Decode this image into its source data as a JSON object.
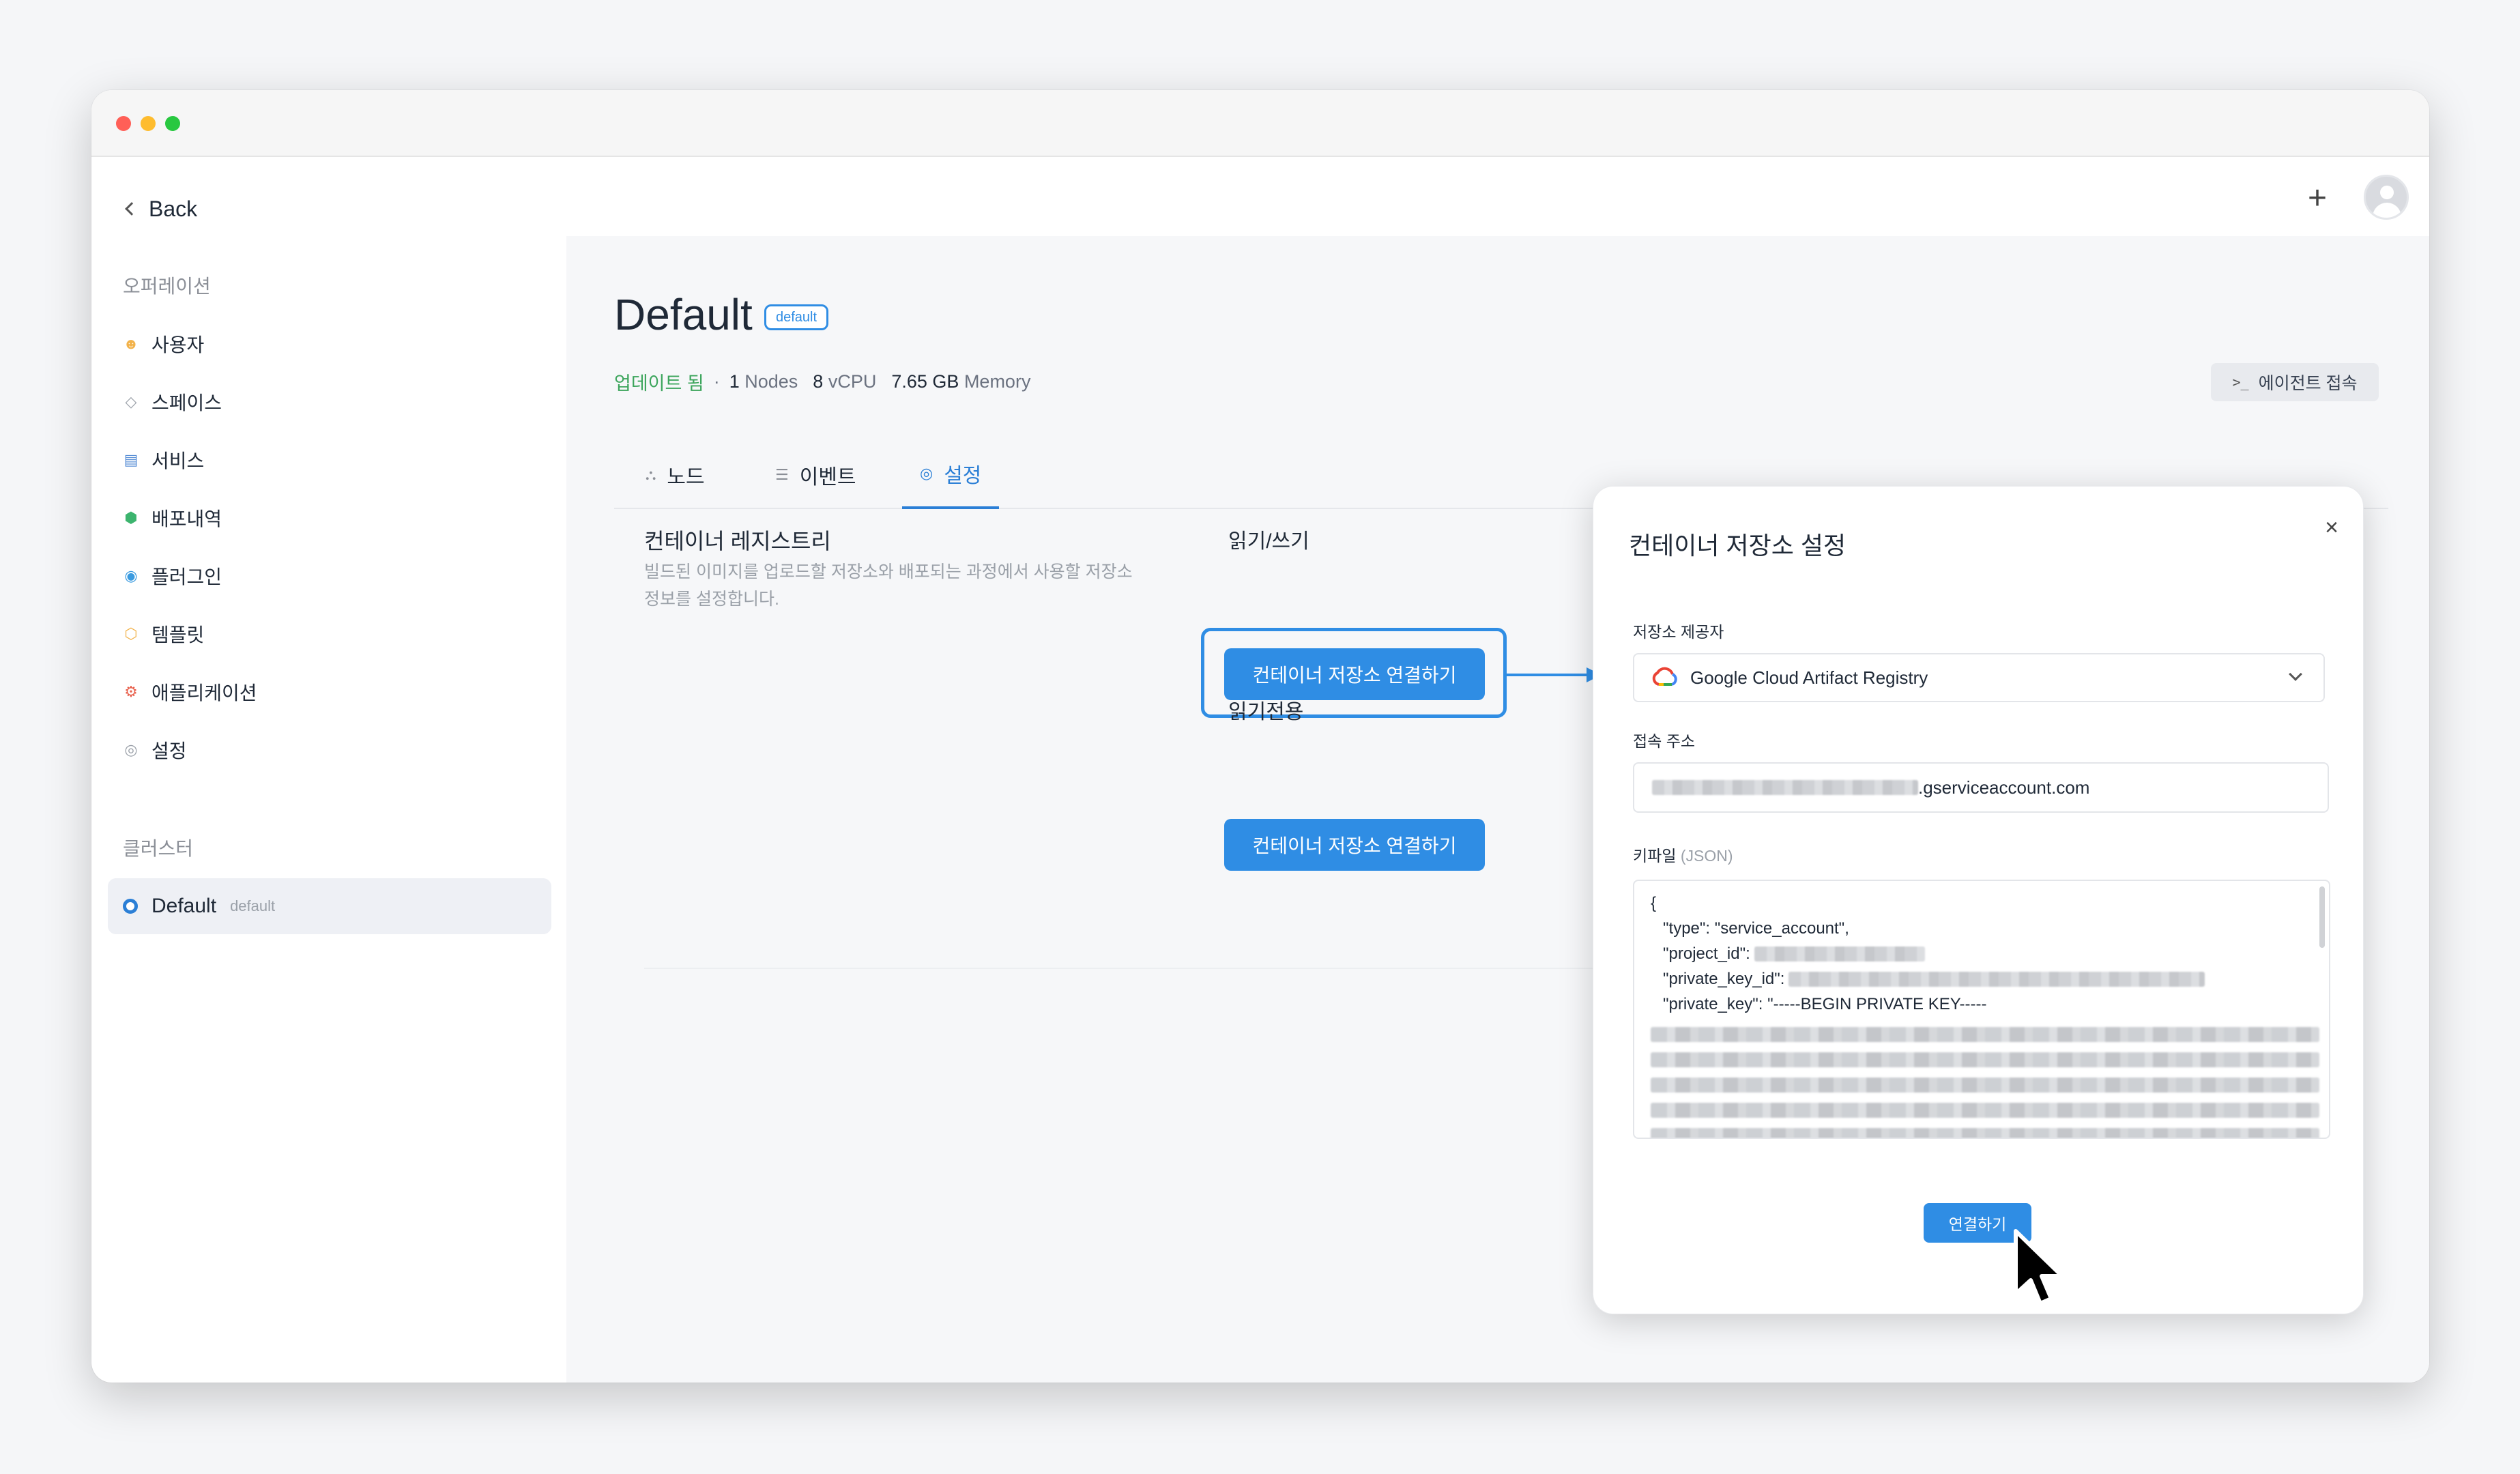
{
  "window": {
    "controls": [
      "close",
      "minimize",
      "maximize"
    ]
  },
  "header": {
    "back_label": "Back",
    "plus_label": "+"
  },
  "sidebar": {
    "section_ops": "오퍼레이션",
    "items": [
      {
        "label": "사용자",
        "icon": "users-icon",
        "color": "#f2b24a"
      },
      {
        "label": "스페이스",
        "icon": "layers-icon",
        "color": "#9aa0a8"
      },
      {
        "label": "서비스",
        "icon": "window-icon",
        "color": "#5a8fd6"
      },
      {
        "label": "배포내역",
        "icon": "box-icon",
        "color": "#3cb46e"
      },
      {
        "label": "플러그인",
        "icon": "plugin-icon",
        "color": "#3a9be0"
      },
      {
        "label": "템플릿",
        "icon": "template-icon",
        "color": "#f2b24a"
      },
      {
        "label": "애플리케이션",
        "icon": "gear-app-icon",
        "color": "#e8604c"
      },
      {
        "label": "설정",
        "icon": "settings-icon",
        "color": "#9aa0a8"
      }
    ],
    "section_cluster": "클러스터",
    "cluster": {
      "name": "Default",
      "tag": "default"
    }
  },
  "page": {
    "title": "Default",
    "badge": "default",
    "status": "업데이트 됨",
    "dot": "·",
    "nodes_count": "1",
    "nodes_label": "Nodes",
    "vcpu_count": "8",
    "vcpu_label": "vCPU",
    "memory_value": "7.65 GB",
    "memory_label": "Memory",
    "agent_button": "에이전트 접속",
    "agent_icon": ">_"
  },
  "tabs": [
    {
      "label": "노드",
      "icon": "⛬"
    },
    {
      "label": "이벤트",
      "icon": "☰"
    },
    {
      "label": "설정",
      "icon": "◎"
    }
  ],
  "registry": {
    "title": "컨테이너 레지스트리",
    "description": "빌드된 이미지를 업로드할 저장소와 배포되는 과정에서 사용할 저장소 정보를 설정합니다.",
    "readwrite_label": "읽기/쓰기",
    "readwrite_button": "컨테이너 저장소 연결하기",
    "readonly_label": "읽기전용",
    "readonly_button": "컨테이너 저장소 연결하기"
  },
  "modal": {
    "title": "컨테이너 저장소 설정",
    "close": "×",
    "provider_label": "저장소 제공자",
    "provider_value": "Google Cloud Artifact Registry",
    "address_label": "접속 주소",
    "address_suffix": ".gserviceaccount.com",
    "keyfile_label": "키파일",
    "keyfile_sub": "(JSON)",
    "json_open": "{",
    "json_type": "\"type\": \"service_account\",",
    "json_project_id": "\"project_id\":",
    "json_private_key_id": "\"private_key_id\":",
    "json_private_key": "\"private_key\": \"-----BEGIN PRIVATE KEY-----",
    "connect_button": "연결하기"
  },
  "colors": {
    "accent": "#2f8de4",
    "success": "#3ca55c"
  }
}
